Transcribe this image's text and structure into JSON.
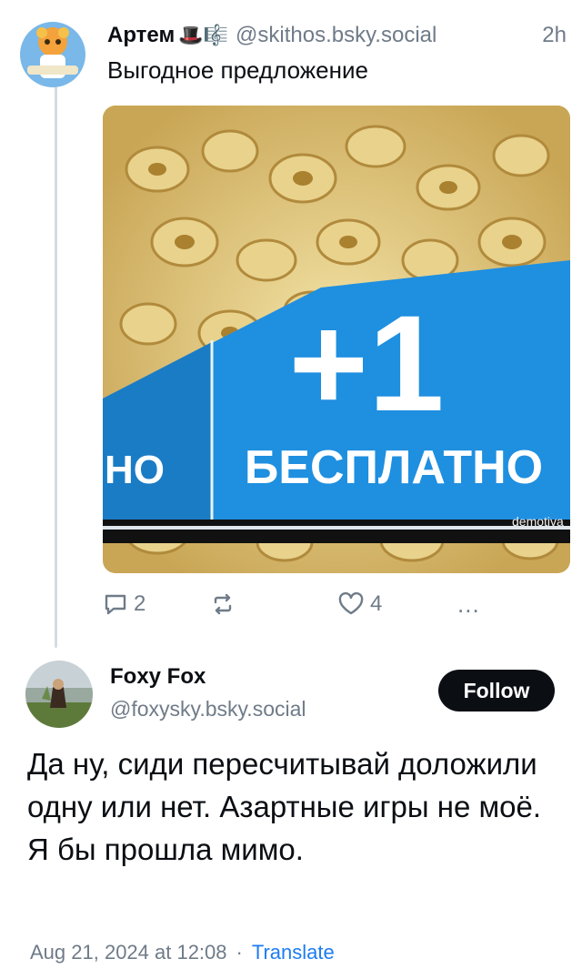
{
  "post": {
    "author": {
      "name": "Артем",
      "emoji": "🎩🎼",
      "handle": "@skithos.bsky.social"
    },
    "time": "2h",
    "text": "Выгодное предложение",
    "image": {
      "label_plus": "+1",
      "label_free": "БЕСПЛАТНО",
      "label_left": "НО",
      "watermark": "demotiva"
    },
    "actions": {
      "reply_count": "2",
      "like_count": "4",
      "more": "..."
    }
  },
  "reply": {
    "author": {
      "name": "Foxy Fox",
      "handle": "@foxysky.bsky.social"
    },
    "follow_label": "Follow",
    "text": "Да ну, сиди пересчитывай доложили одну или нет. Азартные игры не моё. Я бы прошла мимо.",
    "timestamp": "Aug 21, 2024 at 12:08",
    "separator": "·",
    "translate_label": "Translate"
  },
  "colors": {
    "text_primary": "#0b0f14",
    "text_secondary": "#6f7b88",
    "link": "#1d7cf2",
    "follow_bg": "#0b0f14",
    "thread_line": "#d4dbe2",
    "pack_blue": "#1f8fe0"
  },
  "icons": [
    "reply-icon",
    "repost-icon",
    "like-icon",
    "more-icon"
  ]
}
